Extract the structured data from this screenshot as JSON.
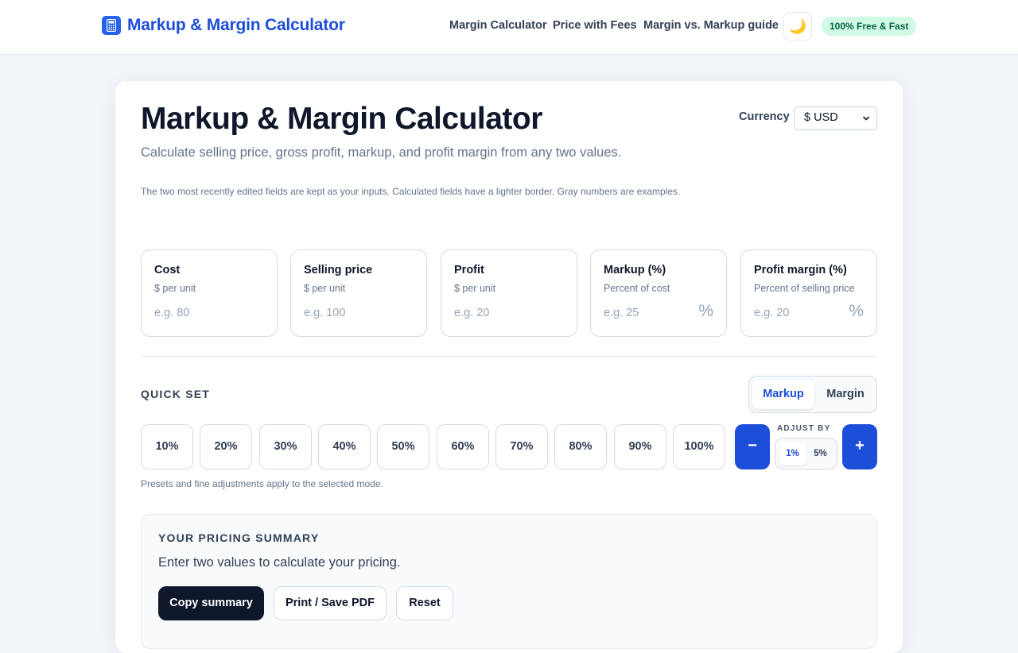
{
  "header": {
    "brand": "Markup & Margin Calculator",
    "nav": [
      "Margin Calculator",
      "Price with Fees",
      "Margin vs. Markup guide"
    ],
    "theme_icon": "moon-icon",
    "badge": "100% Free & Fast"
  },
  "main": {
    "title": "Markup & Margin Calculator",
    "subtitle": "Calculate selling price, gross profit, markup, and profit margin from any two values.",
    "hint": "The two most recently edited fields are kept as your inputs. Calculated fields have a lighter border. Gray numbers are examples.",
    "currency": {
      "label": "Currency",
      "value": "$ USD"
    }
  },
  "fields": [
    {
      "label": "Cost",
      "sub": "$ per unit",
      "placeholder": "e.g. 80",
      "pct": ""
    },
    {
      "label": "Selling price",
      "sub": "$ per unit",
      "placeholder": "e.g. 100",
      "pct": ""
    },
    {
      "label": "Profit",
      "sub": "$ per unit",
      "placeholder": "e.g. 20",
      "pct": ""
    },
    {
      "label": "Markup (%)",
      "sub": "Percent of cost",
      "placeholder": "e.g. 25",
      "pct": "%"
    },
    {
      "label": "Profit margin (%)",
      "sub": "Percent of selling price",
      "placeholder": "e.g. 20",
      "pct": "%"
    }
  ],
  "quick_set": {
    "title": "QUICK SET",
    "modes": [
      "Markup",
      "Margin"
    ],
    "active_mode": "Markup",
    "presets": [
      "10%",
      "20%",
      "30%",
      "40%",
      "50%",
      "60%",
      "70%",
      "80%",
      "90%",
      "100%"
    ],
    "minus": "−",
    "plus": "+",
    "adjust_label": "ADJUST BY",
    "adjust_options": [
      "1%",
      "5%"
    ],
    "note": "Presets and fine adjustments apply to the selected mode."
  },
  "summary": {
    "title": "YOUR PRICING SUMMARY",
    "text": "Enter two values to calculate your pricing.",
    "buttons": [
      "Copy summary",
      "Print / Save PDF",
      "Reset"
    ]
  },
  "colors": {
    "accent": "#1d4ed8",
    "dark": "#0f172a",
    "badge_bg": "#d1fae5",
    "badge_text": "#065f46"
  }
}
